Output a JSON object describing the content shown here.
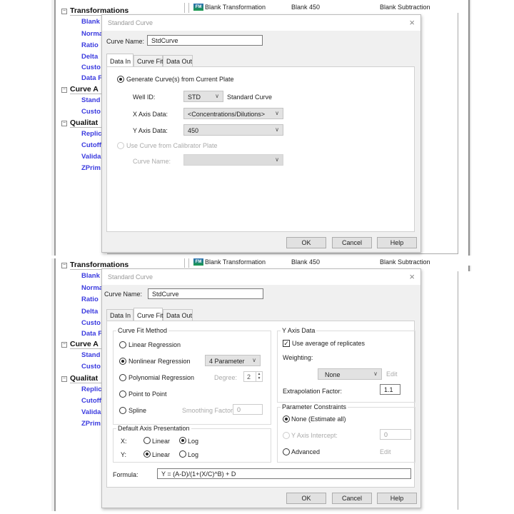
{
  "tree": {
    "groups": [
      {
        "label": "Transformations",
        "items": [
          "Blank",
          "Norma",
          "Ratio",
          "Delta",
          "Custo",
          "Data F"
        ]
      },
      {
        "label": "Curve A",
        "items": [
          "Stand",
          "Custo"
        ]
      },
      {
        "label": "Qualitat",
        "items": [
          "Replic",
          "Cutoff",
          "Valida",
          "ZPrim"
        ]
      }
    ]
  },
  "list_row": {
    "icon": "FM",
    "name": "Blank Transformation",
    "col2": "Blank 450",
    "col3": "Blank Subtraction"
  },
  "dialog": {
    "title": "Standard Curve",
    "close": "×",
    "curve_name_label": "Curve Name:",
    "curve_name_value": "StdCurve",
    "tabs": [
      "Data In",
      "Curve Fit",
      "Data Out"
    ],
    "buttons": {
      "ok": "OK",
      "cancel": "Cancel",
      "help": "Help"
    }
  },
  "data_in": {
    "active_tab": "Data In",
    "generate_label": "Generate Curve(s) from Current Plate",
    "generate_selected": true,
    "well_id_label": "Well ID:",
    "well_id_value": "STD",
    "well_id_desc": "Standard Curve",
    "x_axis_label": "X Axis Data:",
    "x_axis_value": "<Concentrations/Dilutions>",
    "y_axis_label": "Y Axis Data:",
    "y_axis_value": "450",
    "calibrator_label": "Use Curve from Calibrator Plate",
    "calibrator_selected": false,
    "calib_curve_name_label": "Curve Name:",
    "calib_curve_name_value": ""
  },
  "curve_fit": {
    "active_tab": "Curve Fit",
    "method_legend": "Curve Fit Method",
    "methods": [
      {
        "label": "Linear Regression",
        "selected": false
      },
      {
        "label": "Nonlinear Regression",
        "selected": true
      },
      {
        "label": "Polynomial Regression",
        "selected": false
      },
      {
        "label": "Point to Point",
        "selected": false
      },
      {
        "label": "Spline",
        "selected": false
      }
    ],
    "nonlinear_option": "4 Parameter",
    "degree_label": "Degree:",
    "degree_value": "2",
    "smoothing_label": "Smoothing Factor:",
    "smoothing_value": "0",
    "axis_legend": "Default Axis Presentation",
    "x_label": "X:",
    "y_label": "Y:",
    "linear_label": "Linear",
    "log_label": "Log",
    "x_scale": "Log",
    "y_scale": "Linear",
    "y_axis_data_legend": "Y Axis Data",
    "use_average_label": "Use average of replicates",
    "use_average_checked": true,
    "weighting_label": "Weighting:",
    "weighting_value": "None",
    "edit_label": "Edit",
    "extrapolation_label": "Extrapolation Factor:",
    "extrapolation_value": "1.1",
    "constraints_legend": "Parameter Constraints",
    "constraint_none": "None (Estimate all)",
    "constraint_intercept": "Y Axis Intercept:",
    "constraint_intercept_value": "0",
    "constraint_advanced": "Advanced",
    "constraint_selected": "None (Estimate all)",
    "formula_label": "Formula:",
    "formula_value": "Y = (A-D)/(1+(X/C)^B) + D"
  }
}
